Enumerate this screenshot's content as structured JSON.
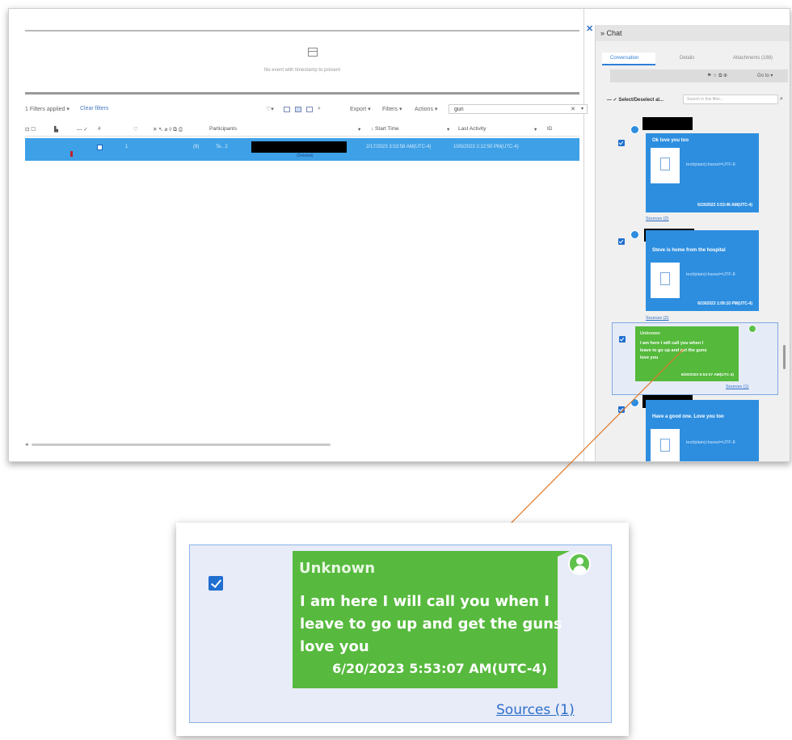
{
  "preview": {
    "message": "No event with timestamp to present"
  },
  "toolbar": {
    "filters_applied": "1 Filters applied",
    "clear_filters": "Clear filters",
    "export": "Export",
    "filters": "Filters",
    "actions": "Actions",
    "search_value": "gun",
    "clear_symbol": "✕"
  },
  "grid": {
    "columns": {
      "participants": "Participants",
      "start_time": "↓ Start Time",
      "last_activity": "Last Activity",
      "id": "ID"
    },
    "row": {
      "index": "1",
      "count": "(9)",
      "source": "Te.. 2",
      "participants_sub": "(Deleted)",
      "start_time": "2/17/2023 3:53:58 AM(UTC-4)",
      "last_activity": "10/5/2023 2:12:50 PM(UTC-4)"
    }
  },
  "chat": {
    "title": "Chat",
    "tabs": [
      "Conversation",
      "Details",
      "Attachments (188)"
    ],
    "tools_goto": "Go to",
    "select_label": "Select/Deselect al...",
    "filter_placeholder": "Search in this filter...",
    "messages": [
      {
        "text": "Ok love you too",
        "attachment": "text/plain(charset=UTF-8",
        "time": "6/19/2023 3:53:46 AM(UTC-4)",
        "sources": "Sources (2)"
      },
      {
        "text": "Steve is home from the hospital",
        "attachment": "text/plain(charset=UTF-8",
        "time": "6/19/2023 1:09:10 PM(UTC-4)",
        "sources": "Sources (2)"
      },
      {
        "text": "Have a good one. Love you too",
        "attachment": "text/plain(charset=UTF-8"
      }
    ],
    "selected_small": {
      "name": "Unknown",
      "lines": [
        "I am here I will call you when I",
        "leave to go up and get the guns",
        "love you"
      ],
      "time": "6/20/2023 5:53:07 AM(UTC-4)",
      "sources": "Sources (1)"
    }
  },
  "zoom": {
    "sender": "Unknown",
    "lines": [
      "I am here I will call you when I",
      "leave to go up and get the guns",
      "love you"
    ],
    "time": "6/20/2023 5:53:07 AM(UTC-4)",
    "sources": "Sources (1)"
  },
  "colors": {
    "accent_blue": "#2d8ee0",
    "row_highlight": "#3ea0e6",
    "green_bubble": "#57ba3e",
    "arrow": "#e07828"
  }
}
